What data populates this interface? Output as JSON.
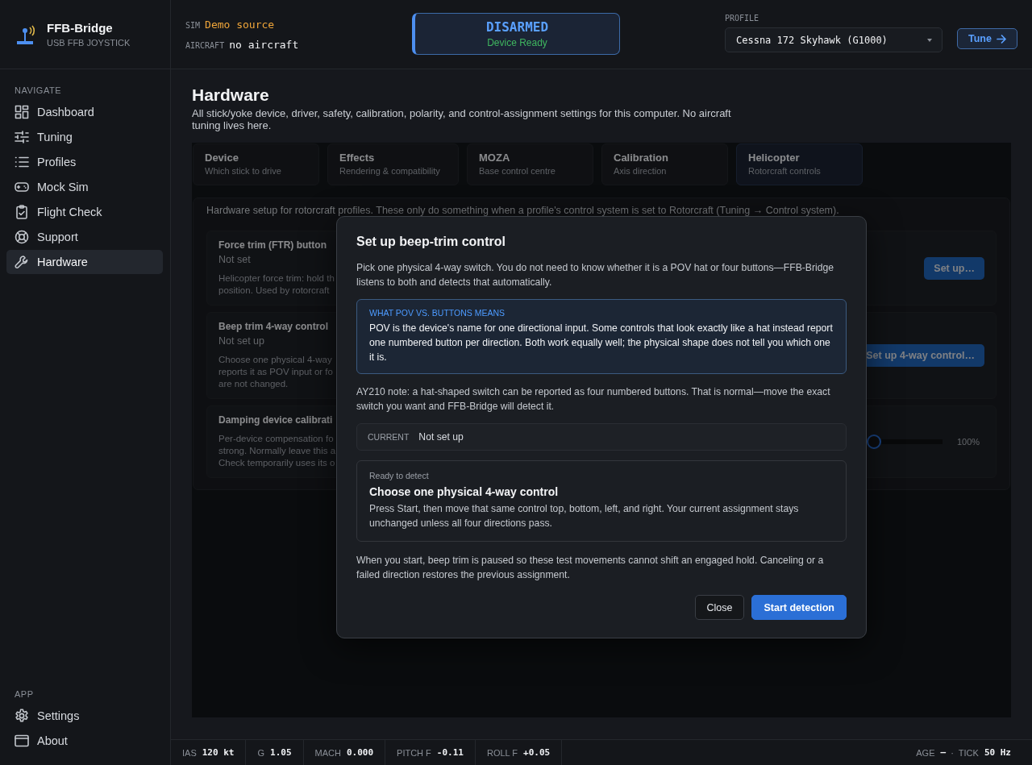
{
  "app": {
    "name": "FFB-Bridge",
    "subtitle": "USB FFB JOYSTICK"
  },
  "top": {
    "sim_label": "SIM",
    "sim_value": "Demo source",
    "aircraft_label": "AIRCRAFT",
    "aircraft_value": "no aircraft",
    "status": {
      "state": "DISARMED",
      "detail": "Device Ready"
    },
    "profile_label": "PROFILE",
    "profile_value": "Cessna 172 Skyhawk (G1000)",
    "tune_button": "Tune"
  },
  "sidebar": {
    "sections": [
      {
        "heading": "NAVIGATE",
        "items": [
          {
            "label": "Dashboard",
            "kind": "dashboard",
            "selected": false
          },
          {
            "label": "Tuning",
            "kind": "tuning",
            "selected": false
          },
          {
            "label": "Profiles",
            "kind": "profiles",
            "selected": false
          },
          {
            "label": "Mock Sim",
            "kind": "gamepad",
            "selected": false
          },
          {
            "label": "Flight Check",
            "kind": "clipboard",
            "selected": false
          },
          {
            "label": "Support",
            "kind": "support",
            "selected": false
          },
          {
            "label": "Hardware",
            "kind": "wrench",
            "selected": true
          }
        ]
      },
      {
        "heading": "APP",
        "items": [
          {
            "label": "Settings",
            "kind": "settings",
            "selected": false
          },
          {
            "label": "About",
            "kind": "window",
            "selected": false
          }
        ]
      }
    ]
  },
  "page": {
    "title": "Hardware",
    "description": "All stick/yoke device, driver, safety, calibration, polarity, and control-assignment settings for this computer. No aircraft tuning lives here."
  },
  "tabs": [
    {
      "title": "Device",
      "subtitle": "Which stick to drive",
      "selected": false
    },
    {
      "title": "Effects",
      "subtitle": "Rendering & compatibility",
      "selected": false
    },
    {
      "title": "MOZA",
      "subtitle": "Base control centre",
      "selected": false
    },
    {
      "title": "Calibration",
      "subtitle": "Axis direction",
      "selected": false
    },
    {
      "title": "Helicopter",
      "subtitle": "Rotorcraft controls",
      "selected": true
    }
  ],
  "panel": {
    "intro": "Hardware setup for rotorcraft profiles. These only do something when a profile's control system is set to Rotorcraft (Tuning → Control system).",
    "rows": [
      {
        "kind": "button",
        "title": "Force trim (FTR) button",
        "status": "Not set",
        "description_lines": [
          "Helicopter force trim: hold th",
          "position. Used by rotorcraft"
        ],
        "button": "Set up…"
      },
      {
        "kind": "button",
        "title": "Beep trim 4-way control",
        "status": "Not set up",
        "description_lines": [
          "Choose one physical 4-way",
          "reports it as POV input or fo",
          "are not changed."
        ],
        "button": "Set up 4-way control…"
      },
      {
        "kind": "slider",
        "title": "Damping device calibrati",
        "description_lines": [
          "Per-device compensation fo",
          "strong. Normally leave this a",
          "Check temporarily uses its o"
        ],
        "level": 0.5,
        "reading": "100%"
      }
    ]
  },
  "dialog": {
    "title": "Set up beep-trim control",
    "intro": "Pick one physical 4-way switch. You do not need to know whether it is a POV hat or four buttons—FFB-Bridge listens to both and detects that automatically.",
    "info": {
      "heading": "WHAT POV VS. BUTTONS MEANS",
      "text": "POV is the device's name for one directional input. Some controls that look exactly like a hat instead report one numbered button per direction. Both work equally well; the physical shape does not tell you which one it is."
    },
    "note": "AY210 note: a hat-shaped switch can be reported as four numbered buttons. That is normal—move the exact switch you want and FFB-Bridge will detect it.",
    "current": {
      "label": "CURRENT",
      "value": "Not set up"
    },
    "detect": {
      "status": "Ready to detect",
      "title": "Choose one physical 4-way control",
      "text": "Press Start, then move that same control top, bottom, left, and right. Your current assignment stays unchanged unless all four directions pass."
    },
    "footer_note": "When you start, beep trim is paused so these test movements cannot shift an engaged hold. Canceling or a failed direction restores the previous assignment.",
    "buttons": [
      {
        "label": "Close",
        "kind": "secondary"
      },
      {
        "label": "Start detection",
        "kind": "primary"
      }
    ]
  },
  "status_bar": {
    "left": [
      {
        "label": "IAS",
        "value": "120 kt"
      },
      {
        "label": "G",
        "value": "1.05"
      },
      {
        "label": "MACH",
        "value": "0.000"
      },
      {
        "label": "PITCH F",
        "value": "-0.11"
      },
      {
        "label": "ROLL F",
        "value": "+0.05"
      }
    ],
    "right": [
      {
        "label": "AGE",
        "value": "—"
      },
      {
        "label": "TICK",
        "value": "50 Hz"
      }
    ],
    "separator": "·"
  }
}
